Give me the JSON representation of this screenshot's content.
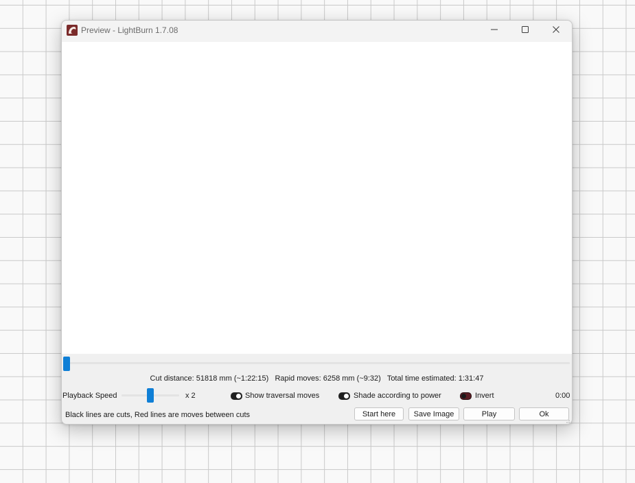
{
  "window": {
    "title": "Preview - LightBurn 1.7.08"
  },
  "stats": {
    "cut_distance": "Cut distance: 51818 mm (~1:22:15)",
    "rapid_moves": "Rapid moves: 6258 mm (~9:32)",
    "total_time": "Total time estimated: 1:31:47"
  },
  "controls": {
    "playback_speed_label": "Playback Speed",
    "playback_speed_value": "x 2",
    "show_traversal_label": "Show traversal moves",
    "show_traversal_on": true,
    "shade_power_label": "Shade according to power",
    "shade_power_on": true,
    "invert_label": "Invert",
    "invert_on": false,
    "elapsed_time": "0:00"
  },
  "footer": {
    "legend_text": "Black lines are cuts, Red lines are moves between cuts",
    "start_here_label": "Start here",
    "save_image_label": "Save Image",
    "play_label": "Play",
    "ok_label": "Ok"
  },
  "colors": {
    "accent": "#0f7fd6",
    "app_icon": "#7a2a2a"
  },
  "icons": [
    "lightburn-app-icon",
    "minimize-icon",
    "maximize-icon",
    "close-icon",
    "resize-grip-icon"
  ]
}
